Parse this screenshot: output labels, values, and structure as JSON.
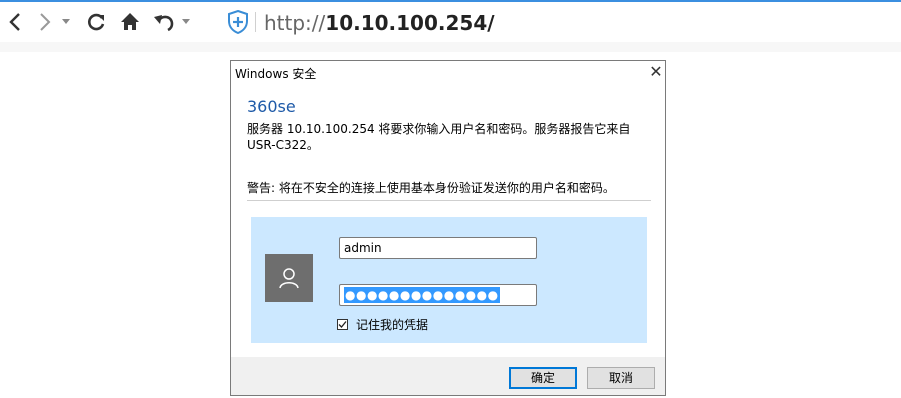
{
  "browser": {
    "url_prefix": "http://",
    "url_host": "10.10.100.254/"
  },
  "dialog": {
    "title": "Windows 安全",
    "close_symbol": "✕",
    "app_name": "360se",
    "message": "服务器 10.10.100.254 将要求你输入用户名和密码。服务器报告它来自 USR-C322。",
    "warning": "警告: 将在不安全的连接上使用基本身份验证发送你的用户名和密码。",
    "username_value": "admin",
    "password_mask": "●●●●●●●●●●●●●●",
    "remember_label": "记住我的凭据",
    "remember_checked": true,
    "ok_label": "确定",
    "cancel_label": "取消"
  },
  "colors": {
    "accent": "#3b8fe0",
    "credential_panel": "#cce8ff",
    "app_name": "#1e5aa8",
    "default_button_border": "#0078d7"
  }
}
